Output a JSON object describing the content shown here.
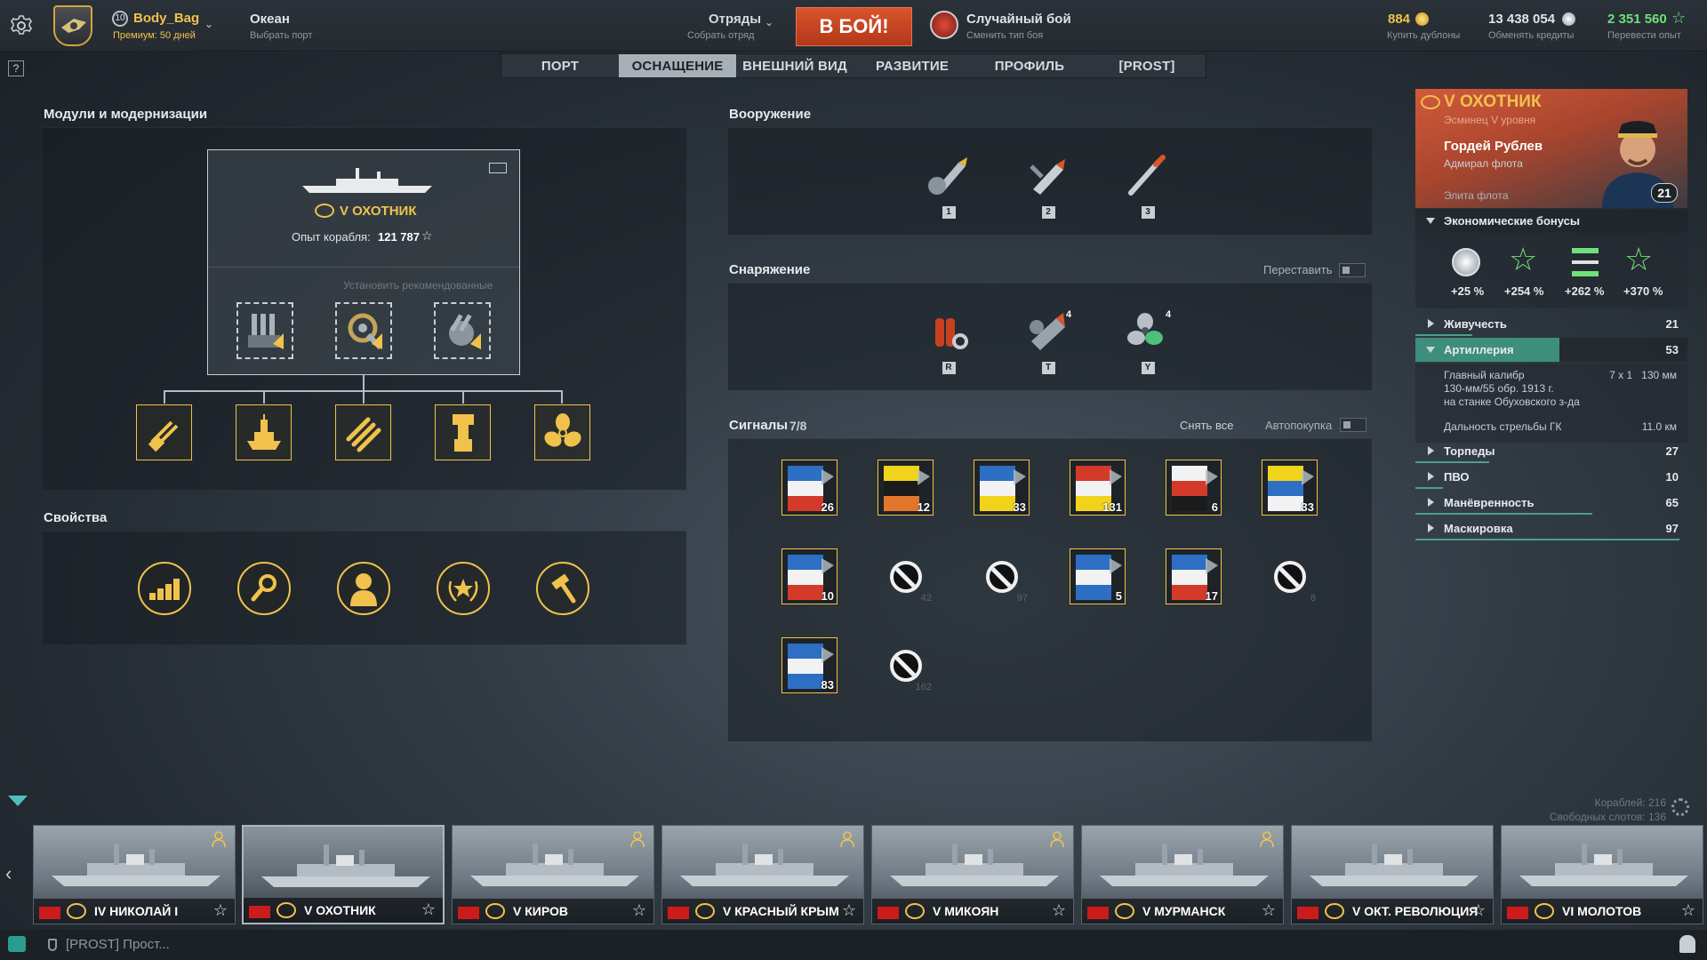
{
  "topbar": {
    "player_level": "10",
    "player_name": "Body_Bag",
    "premium": "Премиум: 50 дней",
    "port_title": "Океан",
    "port_sub": "Выбрать порт",
    "squad_title": "Отряды",
    "squad_sub": "Собрать отряд",
    "battle_button": "В БОЙ!",
    "mode_title": "Случайный бой",
    "mode_sub": "Сменить тип боя",
    "doubloons": "884",
    "doubloons_sub": "Купить дублоны",
    "credits": "13 438 054",
    "credits_sub": "Обменять кредиты",
    "free_xp": "2 351 560",
    "free_xp_sub": "Перевести опыт"
  },
  "help_label": "?",
  "tabs": [
    "ПОРТ",
    "ОСНАЩЕНИЕ",
    "ВНЕШНИЙ ВИД",
    "РАЗВИТИЕ",
    "ПРОФИЛЬ",
    "[PROST]"
  ],
  "modules": {
    "title": "Модули и модернизации",
    "ship_name": "V ОХОТНИК",
    "ship_xp_label": "Опыт корабля:",
    "ship_xp_value": "121 787",
    "install_recommended": "Установить рекомендованные"
  },
  "properties": {
    "title": "Свойства"
  },
  "armament": {
    "title": "Вооружение",
    "keys": [
      "1",
      "2",
      "3"
    ]
  },
  "equipment": {
    "title": "Снаряжение",
    "rearrange": "Переставить",
    "items": [
      {
        "key": "R",
        "count": ""
      },
      {
        "key": "T",
        "count": "4"
      },
      {
        "key": "Y",
        "count": "4"
      }
    ]
  },
  "signals": {
    "title": "Сигналы",
    "count": "7/8",
    "remove_all": "Снять все",
    "autobuy": "Автопокупка",
    "flags": [
      {
        "count": "26",
        "colors": [
          "#2d6fc2",
          "#f2f2f2",
          "#d43a2a"
        ],
        "empty": false
      },
      {
        "count": "12",
        "colors": [
          "#f2d31b",
          "#1b1b1b",
          "#e2762a"
        ],
        "empty": false
      },
      {
        "count": "33",
        "colors": [
          "#2d6fc2",
          "#f2f2f2",
          "#f2d31b"
        ],
        "empty": false
      },
      {
        "count": "131",
        "colors": [
          "#d43a2a",
          "#f2f2f2",
          "#f2d31b"
        ],
        "empty": false
      },
      {
        "count": "6",
        "colors": [
          "#f2f2f2",
          "#d43a2a",
          "#1b1b1b"
        ],
        "empty": false
      },
      {
        "count": "33",
        "colors": [
          "#f2d31b",
          "#2d6fc2",
          "#f2f2f2"
        ],
        "empty": false
      },
      {
        "count": "10",
        "colors": [
          "#2d6fc2",
          "#f2f2f2",
          "#d43a2a"
        ],
        "empty": false
      },
      {
        "count": "42",
        "colors": [],
        "empty": true
      },
      {
        "count": "97",
        "colors": [],
        "empty": true
      },
      {
        "count": "5",
        "colors": [
          "#2d6fc2",
          "#f2f2f2",
          "#2d6fc2"
        ],
        "empty": false
      },
      {
        "count": "17",
        "colors": [
          "#2d6fc2",
          "#f2f2f2",
          "#d43a2a"
        ],
        "empty": false
      },
      {
        "count": "8",
        "colors": [],
        "empty": true
      },
      {
        "count": "83",
        "colors": [
          "#2d6fc2",
          "#f2f2f2",
          "#2d6fc2"
        ],
        "empty": false
      },
      {
        "count": "162",
        "colors": [],
        "empty": true
      }
    ]
  },
  "ship_panel": {
    "ship_name": "V ОХОТНИК",
    "ship_class": "Эсминец V уровня",
    "commander_name": "Гордей Рублев",
    "commander_rank": "Адмирал флота",
    "commander_status": "Элита флота",
    "commander_level": "21",
    "eco_title": "Экономические бонусы",
    "eco_bonuses": [
      "+25 %",
      "+254 %",
      "+262 %",
      "+370 %"
    ],
    "stats": [
      {
        "label": "Живучесть",
        "value": "21",
        "fill": 0.21
      },
      {
        "label": "Артиллерия",
        "value": "53",
        "fill": 0.53
      },
      {
        "label": "Торпеды",
        "value": "27",
        "fill": 0.27
      },
      {
        "label": "ПВО",
        "value": "10",
        "fill": 0.1
      },
      {
        "label": "Манёвренность",
        "value": "65",
        "fill": 0.65
      },
      {
        "label": "Маскировка",
        "value": "97",
        "fill": 0.97
      }
    ],
    "artillery_detail": {
      "main_caliber_label": "Главный калибр",
      "main_caliber_value": "7 x 1   130 мм",
      "gun_line1": "130-мм/55 обр. 1913 г.",
      "gun_line2": "на станке Обуховского з-да",
      "range_label": "Дальность стрельбы ГК",
      "range_value": "11.0 км"
    }
  },
  "carousel": {
    "ships_count": "Кораблей: 216",
    "free_slots": "Свободных слотов: 136",
    "ships": [
      {
        "name": "IV НИКОЛАЙ I",
        "selected": false,
        "commander": true
      },
      {
        "name": "V ОХОТНИК",
        "selected": true,
        "commander": false
      },
      {
        "name": "V КИРОВ",
        "selected": false,
        "commander": true
      },
      {
        "name": "V КРАСНЫЙ КРЫМ",
        "selected": false,
        "commander": true
      },
      {
        "name": "V МИКОЯН",
        "selected": false,
        "commander": true
      },
      {
        "name": "V МУРМАНСК",
        "selected": false,
        "commander": true
      },
      {
        "name": "V ОКТ. РЕВОЛЮЦИЯ",
        "selected": false,
        "commander": false
      },
      {
        "name": "VI МОЛОТОВ",
        "selected": false,
        "commander": false
      }
    ]
  },
  "chat": {
    "text": "[PROST] Прост..."
  },
  "colors": {
    "accent_gold": "#f0c24c",
    "battle_red": "#c8401e",
    "stat_green": "#4d9e8a"
  }
}
